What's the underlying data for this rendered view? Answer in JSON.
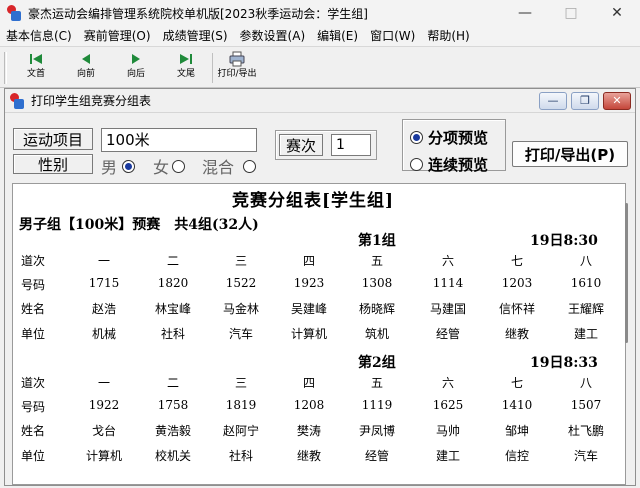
{
  "app": {
    "title": "豪杰运动会编排管理系统院校单机版[2023秋季运动会：学生组]",
    "menu": [
      "基本信息(C)",
      "赛前管理(O)",
      "成绩管理(S)",
      "参数设置(A)",
      "编辑(E)",
      "窗口(W)",
      "帮助(H)"
    ]
  },
  "toolbar": {
    "first": "文首",
    "prev": "向前",
    "next": "向后",
    "last": "文尾",
    "print": "打印/导出"
  },
  "child_window": {
    "title": "打印学生组竞赛分组表"
  },
  "controls": {
    "event_label": "运动项目",
    "event_value": "100米",
    "gender_label": "性别",
    "gender_options": [
      "男",
      "女",
      "混合"
    ],
    "gender_selected": "男",
    "heat_label": "赛次",
    "heat_value": "1",
    "preview_options": [
      "分项预览",
      "连续预览"
    ],
    "preview_selected": "分项预览",
    "print_button": "打印/导出(P)"
  },
  "report": {
    "title": "竞赛分组表[学生组]",
    "event_line": "男子组【100米】预赛　共4组(32人)",
    "row_labels": [
      "道次",
      "号码",
      "姓名",
      "单位"
    ],
    "groups": [
      {
        "title": "第1组",
        "time": "19日8:30",
        "lanes": [
          "一",
          "二",
          "三",
          "四",
          "五",
          "六",
          "七",
          "八"
        ],
        "numbers": [
          "1715",
          "1820",
          "1522",
          "1923",
          "1308",
          "1114",
          "1203",
          "1610"
        ],
        "names": [
          "赵浩",
          "林宝峰",
          "马金林",
          "吴建峰",
          "杨晓辉",
          "马建国",
          "信怀祥",
          "王耀辉"
        ],
        "units": [
          "机械",
          "社科",
          "汽车",
          "计算机",
          "筑机",
          "经管",
          "继教",
          "建工"
        ]
      },
      {
        "title": "第2组",
        "time": "19日8:33",
        "lanes": [
          "一",
          "二",
          "三",
          "四",
          "五",
          "六",
          "七",
          "八"
        ],
        "numbers": [
          "1922",
          "1758",
          "1819",
          "1208",
          "1119",
          "1625",
          "1410",
          "1507"
        ],
        "names": [
          "戈台",
          "黄浩毅",
          "赵阿宁",
          "樊涛",
          "尹凤博",
          "马帅",
          "邹坤",
          "杜飞鹏"
        ],
        "units": [
          "计算机",
          "校机关",
          "社科",
          "继教",
          "经管",
          "建工",
          "信控",
          "汽车"
        ]
      }
    ]
  },
  "colors": {
    "radio_dot": "#1a3a9e",
    "app_icon_red": "#d8262a",
    "app_icon_blue": "#2f6fcf",
    "nav_arrow_green": "#1f8a3a"
  },
  "icons": [
    "first-icon",
    "prev-icon",
    "next-icon",
    "last-icon",
    "printer-icon"
  ]
}
